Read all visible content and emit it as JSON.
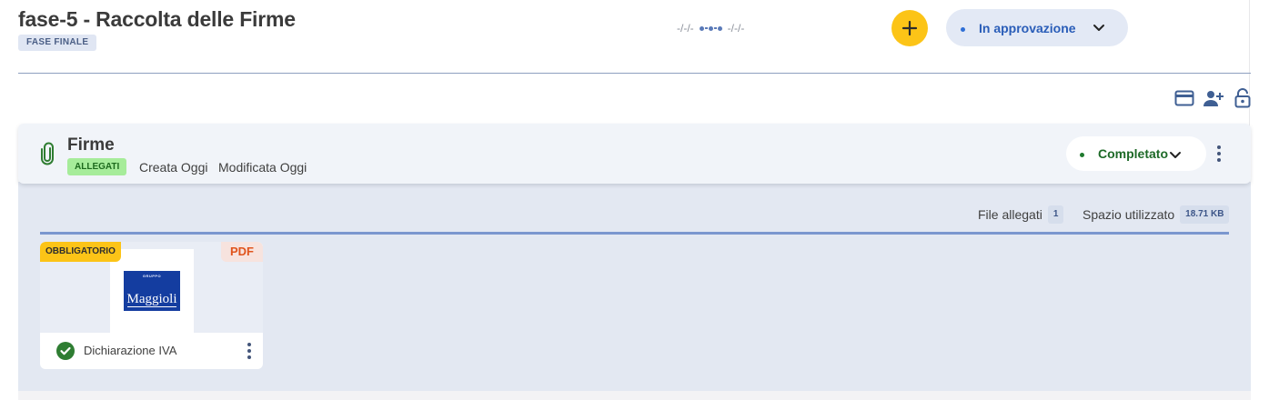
{
  "header": {
    "title": "fase-5 - Raccolta delle Firme",
    "phase_badge": "FASE FINALE",
    "date_start": "-/-/-",
    "date_end": "-/-/-",
    "status": "In approvazione"
  },
  "toolbar": {
    "icons": [
      "credit-card-icon",
      "add-user-icon",
      "unlock-icon"
    ]
  },
  "panel": {
    "title": "Firme",
    "tag": "ALLEGATI",
    "created": "Creata Oggi",
    "modified": "Modificata Oggi",
    "status": "Completato"
  },
  "stats": {
    "files_label": "File allegati",
    "files_count": "1",
    "space_label": "Spazio utilizzato",
    "space_value": "18.71 KB"
  },
  "file": {
    "required_badge": "OBBLIGATORIO",
    "type_badge": "PDF",
    "name": "Dichiarazione IVA",
    "logo_small": "GRUPPO",
    "logo_big": "Maggioli"
  },
  "colors": {
    "accent_yellow": "#fcc417",
    "status_blue": "#2a5db8",
    "status_green": "#1e6a28",
    "pdf_orange": "#e0541c"
  }
}
